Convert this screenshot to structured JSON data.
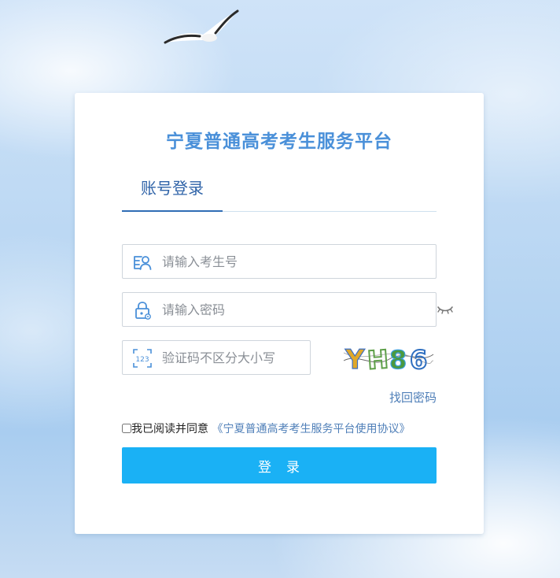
{
  "page": {
    "title": "宁夏普通高考考生服务平台"
  },
  "tabs": [
    {
      "label": "账号登录",
      "active": true
    }
  ],
  "form": {
    "username": {
      "placeholder": "请输入考生号",
      "value": "",
      "icon": "user-card-icon"
    },
    "password": {
      "placeholder": "请输入密码",
      "value": "",
      "icon": "lock-icon",
      "toggle_icon": "eye-closed-icon"
    },
    "captcha": {
      "placeholder": "验证码不区分大小写",
      "value": "",
      "icon": "captcha-123-icon",
      "image_text": "YH86"
    },
    "forgot_label": "找回密码",
    "agreement": {
      "checked": false,
      "label": "我已阅读并同意",
      "link": "《宁夏普通高考考生服务平台使用协议》"
    },
    "submit_label": "登　录"
  },
  "colors": {
    "title": "#4a90d9",
    "tab_active": "#2f63a8",
    "link": "#4f7fb8",
    "button": "#1ab1f5",
    "background": "#bcd8f3"
  }
}
